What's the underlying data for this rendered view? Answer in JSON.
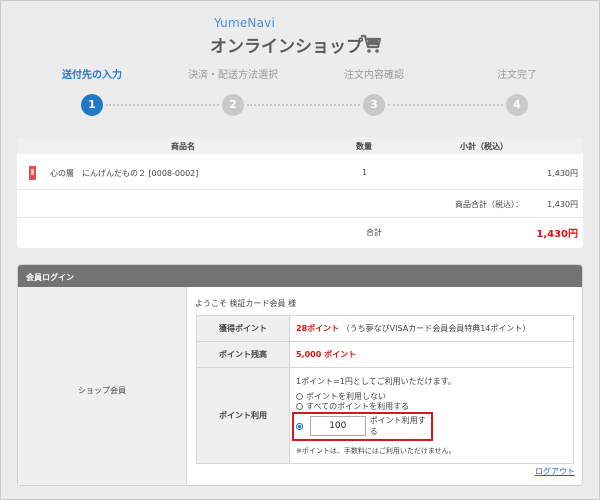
{
  "header": {
    "brand_small": "YumeNavi",
    "brand_main": "オンラインショップ",
    "cart_icon": "cart-icon"
  },
  "steps": [
    {
      "label": "送付先の入力",
      "number": "1",
      "active": true
    },
    {
      "label": "決済・配送方法選択",
      "number": "2",
      "active": false
    },
    {
      "label": "注文内容確認",
      "number": "3",
      "active": false
    },
    {
      "label": "注文完了",
      "number": "4",
      "active": false
    }
  ],
  "product_table": {
    "headers": {
      "name": "商品名",
      "qty": "数量",
      "subtotal": "小計（税込）"
    },
    "row": {
      "name": "心の層　にんげんだもの２ [0008-0002]",
      "qty": "1",
      "price": "1,430円"
    },
    "item_total_label": "商品合計（税込）：",
    "item_total_value": "1,430円",
    "total_label": "合計",
    "total_value": "1,430円"
  },
  "member": {
    "section_title": "会員ログイン",
    "left_label": "ショップ会員",
    "welcome": "ようこそ 検証カード会員 様",
    "earned_label": "獲得ポイント",
    "earned_value": "28ポイント",
    "earned_note": "（うち夢なびVISAカード会員会員特典14ポイント）",
    "balance_label": "ポイント残高",
    "balance_value": "5,000 ポイント",
    "use_label": "ポイント利用",
    "use_info": "1ポイント=1円としてご利用いただけます。",
    "option_none": "ポイントを利用しない",
    "option_all": "すべてのポイントを利用する",
    "points_input": "100",
    "points_suffix": "ポイント利用する",
    "note": "※ポイントは、手数料にはご利用いただけません。",
    "logout": "ログアウト"
  },
  "colors": {
    "accent": "#1f79c4",
    "total_red": "#dd1111",
    "highlight": "#d21a1a"
  }
}
